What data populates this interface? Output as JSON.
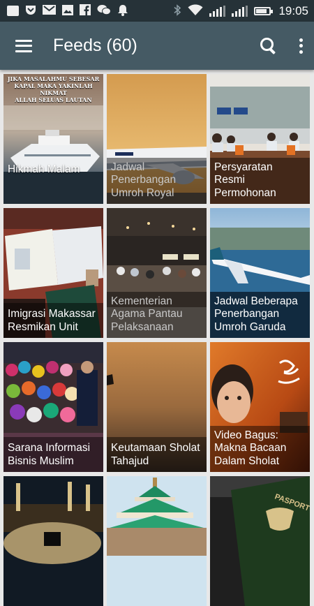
{
  "status_bar": {
    "time": "19:05",
    "left_icons": [
      "chat-icon",
      "pocket-icon",
      "gmail-icon",
      "gallery-icon",
      "facebook-icon",
      "wechat-icon",
      "notification-bell-icon"
    ],
    "right_icons": [
      "bluetooth-icon",
      "wifi-icon",
      "signal-icon",
      "signal-icon",
      "battery-icon"
    ],
    "battery_level": 0.85
  },
  "app_bar": {
    "title": "Feeds (60)",
    "menu_icon": "hamburger-menu-icon",
    "search_icon": "search-icon",
    "overflow_icon": "more-vert-icon",
    "color": "#455a64"
  },
  "feeds": [
    {
      "title": "Hikmah Malam",
      "image": "poster-ship-quote"
    },
    {
      "title": "Jadwal Penerbangan Umroh Royal",
      "image": "airplane-sunset"
    },
    {
      "title": "Persyaratan Resmi Permohonan",
      "image": "immigration-counter"
    },
    {
      "title": "Imigrasi Makassar Resmikan Unit",
      "image": "passports-on-table"
    },
    {
      "title": "Kementerian Agama Pantau Pelaksanaan",
      "image": "airport-terminal-crowd"
    },
    {
      "title": "Jadwal Beberapa Penerbangan Umroh Garuda",
      "image": "garuda-airplane-coast"
    },
    {
      "title": "Sarana Informasi Bisnis Muslim",
      "image": "hijab-market-stall"
    },
    {
      "title": "Keutamaan Sholat Tahajud",
      "image": "night-sky-gradient"
    },
    {
      "title": "Video Bagus: Makna Bacaan Dalam Sholat",
      "image": "child-with-calligraphy"
    },
    {
      "title": "",
      "image": "kaaba-mecca-night"
    },
    {
      "title": "",
      "image": "mosque-green-roof"
    },
    {
      "title": "",
      "image": "indonesian-passport"
    }
  ],
  "poster_text": {
    "line1": "JIKA MASALAHMU SEBESAR",
    "line2": "KAPAL MAKA YAKINLAH NIKMAT",
    "line3": "ALLAH SELUAS LAUTAN"
  }
}
